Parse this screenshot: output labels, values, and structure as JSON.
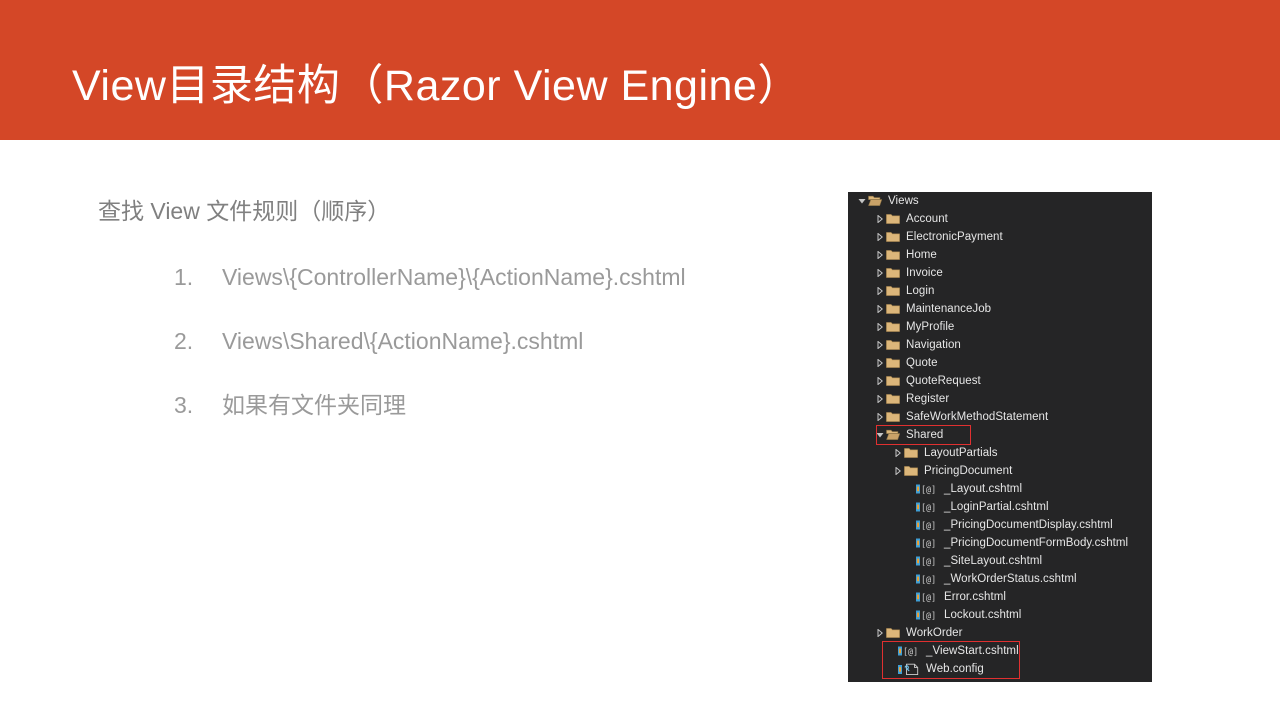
{
  "slide": {
    "title": "View目录结构（Razor View Engine）",
    "banner_color": "#d44727",
    "lead_text": "查找 View 文件规则（顺序）",
    "list": [
      {
        "marker": "1.",
        "text": "Views\\{ControllerName}\\{ActionName}.cshtml"
      },
      {
        "marker": "2.",
        "text": "Views\\Shared\\{ActionName}.cshtml"
      },
      {
        "marker": "3.",
        "text": "如果有文件夹同理"
      }
    ]
  },
  "tree": {
    "background_color": "#252526",
    "text_color": "#e6e6e6",
    "folder_color": "#dcb67a",
    "highlight_color": "#e03030",
    "nodes": [
      {
        "label": "Views",
        "type": "folder-open",
        "level": 0,
        "twisty": "expanded"
      },
      {
        "label": "Account",
        "type": "folder",
        "level": 1,
        "twisty": "collapsed"
      },
      {
        "label": "ElectronicPayment",
        "type": "folder",
        "level": 1,
        "twisty": "collapsed"
      },
      {
        "label": "Home",
        "type": "folder",
        "level": 1,
        "twisty": "collapsed"
      },
      {
        "label": "Invoice",
        "type": "folder",
        "level": 1,
        "twisty": "collapsed"
      },
      {
        "label": "Login",
        "type": "folder",
        "level": 1,
        "twisty": "collapsed"
      },
      {
        "label": "MaintenanceJob",
        "type": "folder",
        "level": 1,
        "twisty": "collapsed"
      },
      {
        "label": "MyProfile",
        "type": "folder",
        "level": 1,
        "twisty": "collapsed"
      },
      {
        "label": "Navigation",
        "type": "folder",
        "level": 1,
        "twisty": "collapsed"
      },
      {
        "label": "Quote",
        "type": "folder",
        "level": 1,
        "twisty": "collapsed"
      },
      {
        "label": "QuoteRequest",
        "type": "folder",
        "level": 1,
        "twisty": "collapsed"
      },
      {
        "label": "Register",
        "type": "folder",
        "level": 1,
        "twisty": "collapsed"
      },
      {
        "label": "SafeWorkMethodStatement",
        "type": "folder",
        "level": 1,
        "twisty": "collapsed"
      },
      {
        "label": "Shared",
        "type": "folder-open",
        "level": 1,
        "twisty": "expanded"
      },
      {
        "label": "LayoutPartials",
        "type": "folder",
        "level": 2,
        "twisty": "collapsed"
      },
      {
        "label": "PricingDocument",
        "type": "folder",
        "level": 2,
        "twisty": "collapsed"
      },
      {
        "label": "_Layout.cshtml",
        "type": "cshtml",
        "level": 2,
        "twisty": "none"
      },
      {
        "label": "_LoginPartial.cshtml",
        "type": "cshtml",
        "level": 2,
        "twisty": "none"
      },
      {
        "label": "_PricingDocumentDisplay.cshtml",
        "type": "cshtml",
        "level": 2,
        "twisty": "none"
      },
      {
        "label": "_PricingDocumentFormBody.cshtml",
        "type": "cshtml",
        "level": 2,
        "twisty": "none"
      },
      {
        "label": "_SiteLayout.cshtml",
        "type": "cshtml",
        "level": 2,
        "twisty": "none"
      },
      {
        "label": "_WorkOrderStatus.cshtml",
        "type": "cshtml",
        "level": 2,
        "twisty": "none"
      },
      {
        "label": "Error.cshtml",
        "type": "cshtml",
        "level": 2,
        "twisty": "none"
      },
      {
        "label": "Lockout.cshtml",
        "type": "cshtml",
        "level": 2,
        "twisty": "none"
      },
      {
        "label": "WorkOrder",
        "type": "folder",
        "level": 1,
        "twisty": "collapsed"
      },
      {
        "label": "_ViewStart.cshtml",
        "type": "cshtml",
        "level": 1,
        "twisty": "none"
      },
      {
        "label": "Web.config",
        "type": "config",
        "level": 1,
        "twisty": "none"
      }
    ],
    "annotations": [
      {
        "name": "shared-folder-highlight",
        "target": "Shared"
      },
      {
        "name": "viewstart-webconfig-highlight",
        "target": "_ViewStart.cshtml / Web.config"
      }
    ]
  }
}
